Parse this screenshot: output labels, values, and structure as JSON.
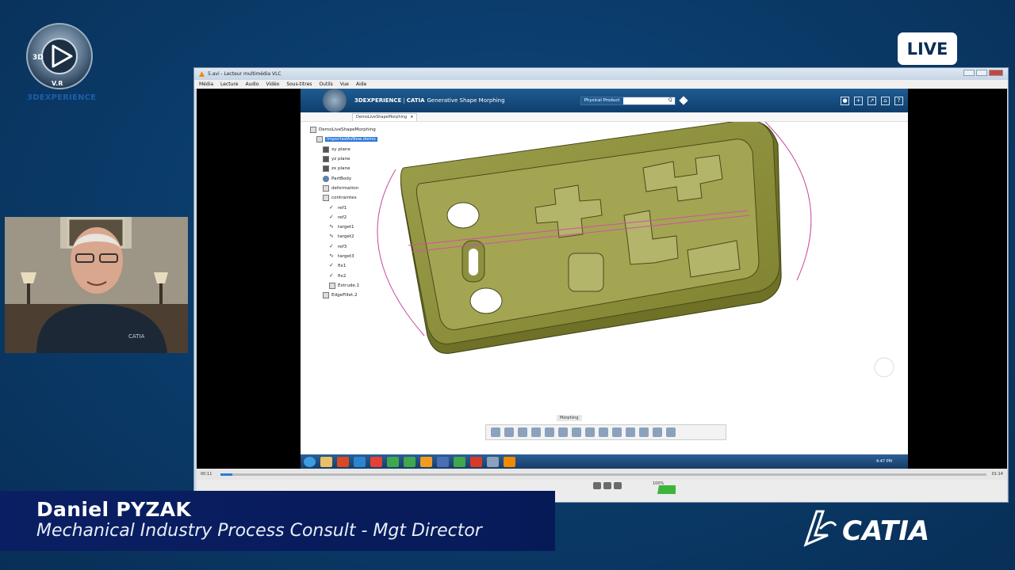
{
  "overlay": {
    "brand_logo_text": "3DEXPERIENCE",
    "brand_logo_letters": {
      "top": "3D",
      "right": "V.R",
      "left": "3D"
    },
    "live_label": "LIVE",
    "speaker_name": "Daniel PYZAK",
    "speaker_role": "Mechanical Industry Process Consult - Mgt Director",
    "catia_brand": "CATIA"
  },
  "vlc": {
    "title": "5.avi - Lecteur multimédia VLC",
    "menu": [
      "Média",
      "Lecture",
      "Audio",
      "Vidéo",
      "Sous-titres",
      "Outils",
      "Vue",
      "Aide"
    ],
    "time_elapsed": "00:11",
    "time_total": "01:14",
    "progress": 0.016,
    "volume_pct": "100%"
  },
  "app": {
    "window_title": "3DEXPERIENCE",
    "brand": "3DEXPERIENCE",
    "product": "CATIA",
    "app_name": "Generative Shape Morphing",
    "search_scope": "Physical Product",
    "tab_label": "DemoLiveShapeMorphing",
    "tree": [
      {
        "label": "DemoLiveShapeMorphing",
        "icon": "product-icon",
        "indent": 0
      },
      {
        "label": "ImportedAsNew.demo",
        "icon": "part-icon",
        "indent": 1,
        "selected": true
      },
      {
        "label": "xy plane",
        "icon": "plane-icon",
        "indent": 2
      },
      {
        "label": "yz plane",
        "icon": "plane-icon",
        "indent": 2
      },
      {
        "label": "zx plane",
        "icon": "plane-icon",
        "indent": 2
      },
      {
        "label": "PartBody",
        "icon": "body-icon",
        "indent": 2
      },
      {
        "label": "deformation",
        "icon": "geometry-icon",
        "indent": 2
      },
      {
        "label": "contraintes",
        "icon": "geometry-icon",
        "indent": 2
      },
      {
        "label": "ref1",
        "icon": "check-icon",
        "indent": 3
      },
      {
        "label": "ref2",
        "icon": "check-icon",
        "indent": 3
      },
      {
        "label": "target1",
        "icon": "curve-icon",
        "indent": 3
      },
      {
        "label": "target2",
        "icon": "curve-icon",
        "indent": 3
      },
      {
        "label": "ref3",
        "icon": "check-icon",
        "indent": 3
      },
      {
        "label": "target3",
        "icon": "curve-icon",
        "indent": 3
      },
      {
        "label": "fix1",
        "icon": "check-icon",
        "indent": 3
      },
      {
        "label": "fix2",
        "icon": "check-icon",
        "indent": 3
      },
      {
        "label": "Extrude.1",
        "icon": "extrude-icon",
        "indent": 3
      },
      {
        "label": "EdgeFillet.2",
        "icon": "fillet-icon",
        "indent": 2
      }
    ],
    "toolbar_label": "Morphing",
    "clock": "4:47 PM"
  },
  "colors": {
    "background": "#0a3a68",
    "lower_third": "#0a1f63",
    "part_face": "#8a8c3e",
    "accent": "#2f78d8"
  }
}
